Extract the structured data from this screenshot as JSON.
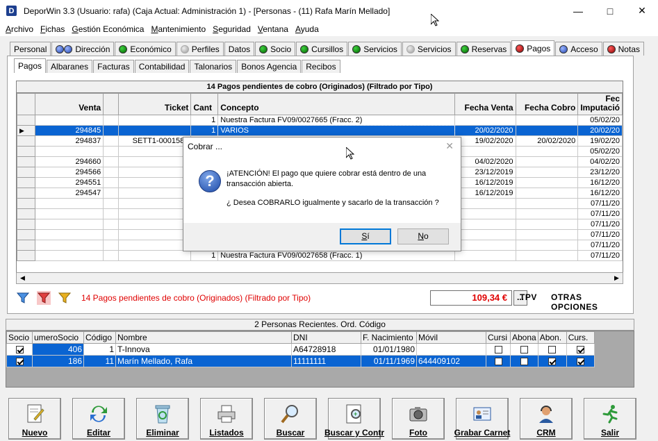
{
  "window": {
    "title": "DeporWin 3.3  (Usuario: rafa)  (Caja Actual: Administración 1) - [Personas - (11) Rafa Marín Mellado]",
    "app_icon_letter": "D"
  },
  "menu": [
    {
      "u": "A",
      "rest": "rchivo"
    },
    {
      "u": "F",
      "rest": "ichas"
    },
    {
      "u": "G",
      "rest": "estión Económica"
    },
    {
      "u": "M",
      "rest": "antenimiento"
    },
    {
      "u": "S",
      "rest": "eguridad"
    },
    {
      "u": "V",
      "rest": "entana"
    },
    {
      "u": "A",
      "rest": "yuda"
    }
  ],
  "outer_tabs": [
    {
      "label": "Personal",
      "icon": "none"
    },
    {
      "label": "Dirección",
      "icon": "blue-dual"
    },
    {
      "label": "Económico",
      "icon": "green"
    },
    {
      "label": "Perfiles",
      "icon": "gray"
    },
    {
      "label": "Datos",
      "icon": "none"
    },
    {
      "label": "Socio",
      "icon": "green"
    },
    {
      "label": "Cursillos",
      "icon": "green"
    },
    {
      "label": "Servicios",
      "icon": "green"
    },
    {
      "label": "Servicios",
      "icon": "gray"
    },
    {
      "label": "Reservas",
      "icon": "green"
    },
    {
      "label": "Pagos",
      "icon": "red",
      "active": true
    },
    {
      "label": "Acceso",
      "icon": "blue"
    },
    {
      "label": "Notas",
      "icon": "red"
    }
  ],
  "inner_tabs": [
    "Pagos",
    "Albaranes",
    "Facturas",
    "Contabilidad",
    "Talonarios",
    "Bonos Agencia",
    "Recibos"
  ],
  "grid": {
    "caption": "14 Pagos pendientes de cobro (Originados) (Filtrado por Tipo)",
    "columns": [
      "",
      "Venta",
      "",
      "Ticket",
      "Cant",
      "Concepto",
      "Fecha Venta",
      "Fecha Cobro",
      "Fecha Imputación"
    ],
    "column_labels": {
      "c1": "Venta",
      "c3": "Ticket",
      "c4": "Cant",
      "c5": "Concepto",
      "c6": "Fecha Venta",
      "c7": "Fecha Cobro",
      "c8a": "Fec",
      "c8b": "Imputació"
    },
    "rows": [
      {
        "venta": "",
        "ticket": "",
        "cant": "1",
        "concepto": "Nuestra Factura FV09/0027665 (Fracc. 2)",
        "fventa": "",
        "fcobro": "",
        "fimp": "05/02/20"
      },
      {
        "venta": "294845",
        "ticket": "",
        "cant": "1",
        "concepto": "VARIOS",
        "fventa": "20/02/2020",
        "fcobro": "",
        "fimp": "20/02/20",
        "selected": true
      },
      {
        "venta": "294837",
        "ticket": "SETT1-0001585",
        "cant": "",
        "concepto": "",
        "fventa": "19/02/2020",
        "fcobro": "20/02/2020",
        "fimp": "19/02/20"
      },
      {
        "venta": "",
        "ticket": "",
        "cant": "",
        "concepto": "",
        "fventa": "",
        "fcobro": "",
        "fimp": "05/02/20"
      },
      {
        "venta": "294660",
        "ticket": "",
        "cant": "",
        "concepto": "",
        "fventa": "04/02/2020",
        "fcobro": "",
        "fimp": "04/02/20"
      },
      {
        "venta": "294566",
        "ticket": "",
        "cant": "",
        "concepto": "",
        "fventa": "23/12/2019",
        "fcobro": "",
        "fimp": "23/12/20"
      },
      {
        "venta": "294551",
        "ticket": "",
        "cant": "",
        "concepto": "",
        "fventa": "16/12/2019",
        "fcobro": "",
        "fimp": "16/12/20"
      },
      {
        "venta": "294547",
        "ticket": "",
        "cant": "",
        "concepto": "",
        "fventa": "16/12/2019",
        "fcobro": "",
        "fimp": "16/12/20"
      },
      {
        "venta": "",
        "ticket": "",
        "cant": "",
        "concepto": "",
        "fventa": "",
        "fcobro": "",
        "fimp": "07/11/20"
      },
      {
        "venta": "",
        "ticket": "",
        "cant": "",
        "concepto": "",
        "fventa": "",
        "fcobro": "",
        "fimp": "07/11/20"
      },
      {
        "venta": "",
        "ticket": "",
        "cant": "",
        "concepto": "",
        "fventa": "",
        "fcobro": "",
        "fimp": "07/11/20"
      },
      {
        "venta": "",
        "ticket": "",
        "cant": "",
        "concepto": "",
        "fventa": "",
        "fcobro": "",
        "fimp": "07/11/20"
      },
      {
        "venta": "",
        "ticket": "",
        "cant": "",
        "concepto": "",
        "fventa": "",
        "fcobro": "",
        "fimp": "07/11/20"
      },
      {
        "venta": "",
        "ticket": "",
        "cant": "1",
        "concepto": "Nuestra Factura FV09/0027658 (Fracc. 1)",
        "fventa": "",
        "fcobro": "",
        "fimp": "07/11/20"
      }
    ]
  },
  "filter_bar": {
    "text": "14 Pagos pendientes de cobro (Originados) (Filtrado por Tipo)",
    "total": "109,34 €",
    "ellipsis": "...",
    "tpv": "TPV",
    "otras": "OTRAS OPCIONES",
    "colors": {
      "text": "#e00000"
    }
  },
  "personas": {
    "caption": "2 Personas Recientes. Ord. Código",
    "columns": [
      "Socio",
      "umeroSocio",
      "Código",
      "Nombre",
      "DNI",
      "F. Nacimiento",
      "Móvil",
      "Cursi",
      "Abona",
      "Abon.",
      "Curs."
    ],
    "rows": [
      {
        "socio": true,
        "numero": "406",
        "codigo": "1",
        "nombre": "T-Innova",
        "dni": "A64728918",
        "fnac": "01/01/1980",
        "movil": "",
        "cursi": false,
        "abona": false,
        "abon": false,
        "curs": true
      },
      {
        "socio": true,
        "numero": "186",
        "codigo": "11",
        "nombre": "Marín Mellado, Rafa",
        "dni": "11111111",
        "fnac": "01/11/1969",
        "movil": "644409102",
        "cursi": false,
        "abona": false,
        "abon": true,
        "curs": true,
        "selected": true
      }
    ]
  },
  "toolbar": [
    {
      "label": "Nuevo",
      "icon": "new-doc-icon"
    },
    {
      "label": "Editar",
      "icon": "refresh-arrows-icon"
    },
    {
      "label": "Eliminar",
      "icon": "recycle-bin-icon"
    },
    {
      "label": "Listados",
      "icon": "printer-icon"
    },
    {
      "label": "Buscar",
      "icon": "magnifier-icon"
    },
    {
      "label": "Buscar y Contr",
      "icon": "search-doc-icon"
    },
    {
      "label": "Foto",
      "icon": "camera-icon"
    },
    {
      "label": "Grabar Carnet",
      "icon": "id-card-icon"
    },
    {
      "label": "CRM",
      "icon": "headset-icon"
    },
    {
      "label": "Salir",
      "icon": "running-man-icon"
    }
  ],
  "dialog": {
    "title": "Cobrar ...",
    "line1": "¡ATENCIÓN! El pago que quiere cobrar está dentro de una",
    "line2": "transacción abierta.",
    "line3": "¿ Desea COBRARLO igualmente y sacarlo de la transacción ?",
    "yes_u": "S",
    "yes_rest": "í",
    "no_u": "N",
    "no_rest": "o"
  },
  "colors": {
    "selection": "#0a64d2",
    "accent_red": "#e00000"
  }
}
